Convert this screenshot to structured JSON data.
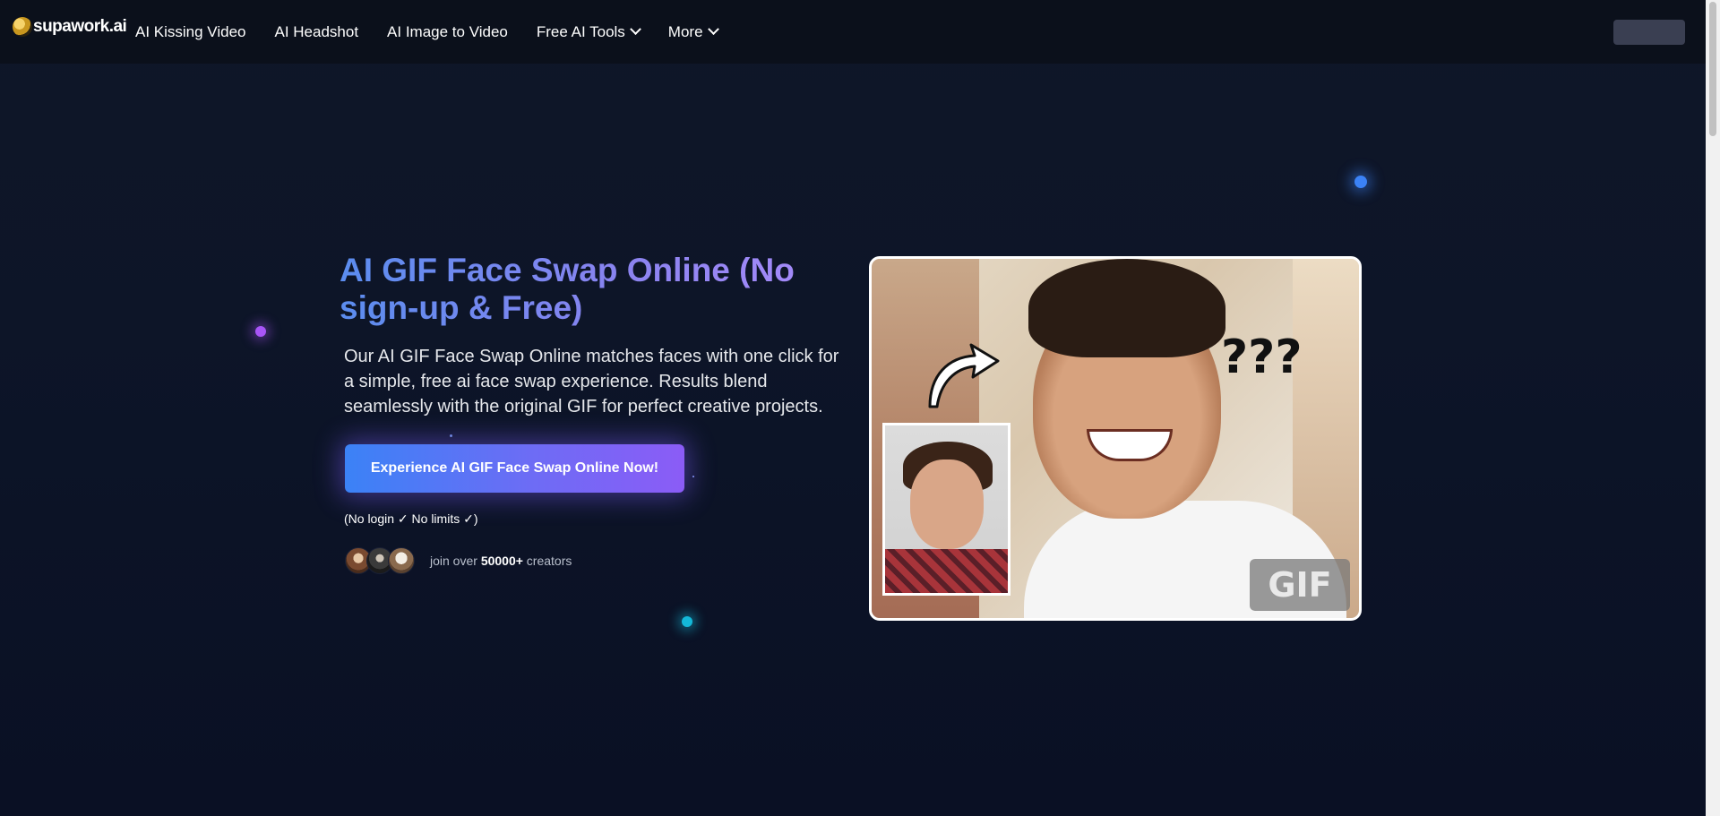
{
  "nav": {
    "logo_text": "supawork.ai",
    "items": [
      {
        "label": "AI Kissing Video"
      },
      {
        "label": "AI Headshot"
      },
      {
        "label": "AI Image to Video"
      },
      {
        "label": "Free AI Tools",
        "icon": "chevron-down-icon"
      },
      {
        "label": "More",
        "icon": "chevron-down-icon"
      }
    ],
    "button_label": ""
  },
  "hero": {
    "title": "AI GIF Face Swap Online (No sign-up & Free)",
    "description": "Our AI GIF Face Swap Online matches faces with one click for a simple, free ai face swap experience. Results blend seamlessly with the original GIF for perfect creative projects.",
    "cta_label": "Experience AI GIF Face Swap Online Now!",
    "no_login": "(No login ✓ No limits ✓)",
    "join_prefix": "join over ",
    "join_count": "50000+",
    "join_suffix": " creators"
  },
  "image": {
    "question_marks": "???",
    "badge": "GIF"
  },
  "colors": {
    "background": "#0d1528",
    "navbar": "#0b101b",
    "accent_blue": "#3b82f6",
    "accent_purple": "#8b5cf6"
  }
}
